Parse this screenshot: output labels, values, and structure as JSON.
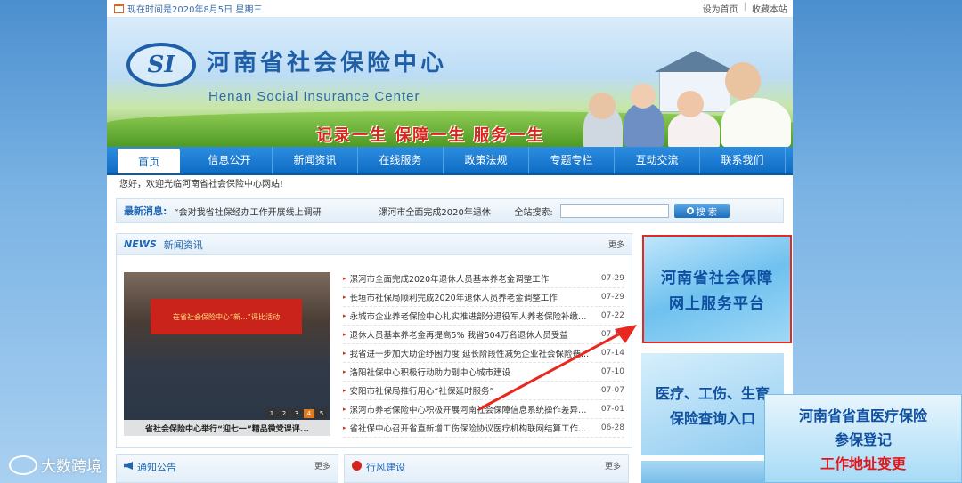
{
  "topbar": {
    "date_text": "现在时间是2020年8月5日 星期三",
    "set_home": "设为首页",
    "separator": "|",
    "bookmark": "收藏本站"
  },
  "banner": {
    "logo_text": "SI",
    "title_cn": "河南省社会保险中心",
    "title_en": "Henan Social Insurance Center",
    "slogan": "记录一生 保障一生 服务一生"
  },
  "nav": {
    "items": [
      "首页",
      "信息公开",
      "新闻资讯",
      "在线服务",
      "政策法规",
      "专题专栏",
      "互动交流",
      "联系我们"
    ]
  },
  "welcome": "您好，欢迎光临河南省社会保险中心网站!",
  "ticker": {
    "label": "最新消息:",
    "news1": "“会对我省社保经办工作开展线上调研",
    "news2": "漯河市全面完成2020年退休",
    "search_label": "全站搜索:",
    "search_placeholder": "",
    "search_button": "搜 索"
  },
  "news": {
    "en_title": "NEWS",
    "cn_title": "新闻资讯",
    "more": "更多",
    "photo_banner": "在省社会保险中心“新...”评比活动",
    "photo_caption": "省社会保险中心举行“迎七一”精品微党课评...",
    "photo_pages": [
      "1",
      "2",
      "3",
      "4",
      "5"
    ],
    "items": [
      {
        "title": "漯河市全面完成2020年退休人员基本养老金调整工作",
        "date": "07-29"
      },
      {
        "title": "长垣市社保局顺利完成2020年退休人员养老金调整工作",
        "date": "07-29"
      },
      {
        "title": "永城市企业养老保险中心扎实推进部分退役军人养老保险补缴工...",
        "date": "07-22"
      },
      {
        "title": "退休人员基本养老金再提高5% 我省504万名退休人员受益",
        "date": "07-17"
      },
      {
        "title": "我省进一步加大助企纾困力度 延长阶段性减免企业社会保险费...",
        "date": "07-14"
      },
      {
        "title": "洛阳社保中心积极行动助力副中心城市建设",
        "date": "07-10"
      },
      {
        "title": "安阳市社保局推行用心“社保延时服务”",
        "date": "07-07"
      },
      {
        "title": "漯河市养老保险中心积极开展河南社会保障信息系统操作差异化...",
        "date": "07-01"
      },
      {
        "title": "省社保中心召开省直新增工伤保险协议医疗机构联网结算工作座...",
        "date": "06-28"
      }
    ]
  },
  "notice": {
    "title": "通知公告",
    "more": "更多"
  },
  "style": {
    "title": "行风建设",
    "more": "更多"
  },
  "right": {
    "platform_l1": "河南省社会保障",
    "platform_l2": "网上服务平台",
    "medical_l1": "医疗、工伤、生育",
    "medical_l2": "保险查询入口"
  },
  "float_ad": {
    "l1": "河南省省直医疗保险",
    "l2": "参保登记",
    "l3": "工作地址变更"
  },
  "watermark": "大数跨境",
  "colors": {
    "brand_blue": "#1f66b2",
    "nav_blue": "#0f6bc3",
    "accent_red": "#e12a26"
  }
}
